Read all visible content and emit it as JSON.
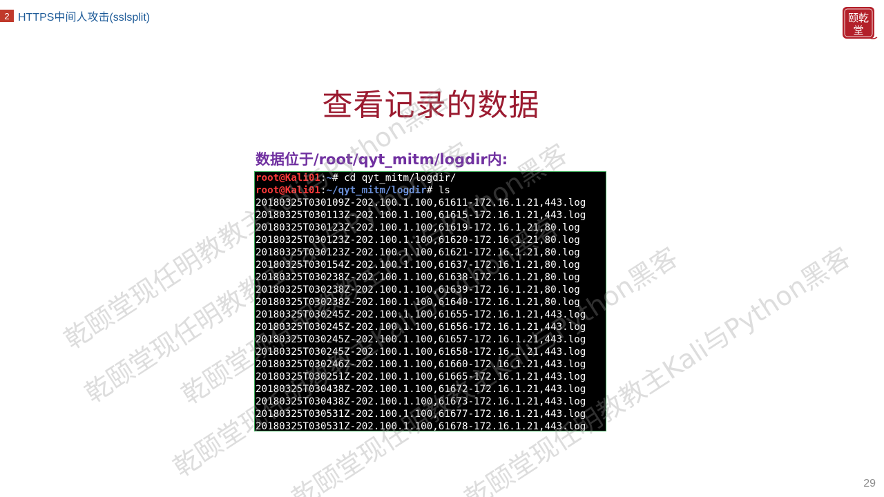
{
  "header": {
    "section_number": "2",
    "section_title": "HTTPS中间人攻击(sslsplit)"
  },
  "seal": {
    "text_top": "颐乾",
    "text_bottom": "堂"
  },
  "slide": {
    "title": "查看记录的数据",
    "subtitle": "数据位于/root/qyt_mitm/logdir内:"
  },
  "terminal": {
    "command1": {
      "user": "root@Kali01",
      "sep": ":",
      "path": "~",
      "suffix": "# cd qyt_mitm/logdir/"
    },
    "command2": {
      "user": "root@Kali01",
      "sep": ":",
      "path": "~/qyt_mitm/logdir",
      "suffix": "# ls"
    },
    "files": [
      "20180325T030109Z-202.100.1.100,61611-172.16.1.21,443.log",
      "20180325T030113Z-202.100.1.100,61615-172.16.1.21,443.log",
      "20180325T030123Z-202.100.1.100,61619-172.16.1.21,80.log",
      "20180325T030123Z-202.100.1.100,61620-172.16.1.21,80.log",
      "20180325T030123Z-202.100.1.100,61621-172.16.1.21,80.log",
      "20180325T030154Z-202.100.1.100,61637-172.16.1.21,80.log",
      "20180325T030238Z-202.100.1.100,61638-172.16.1.21,80.log",
      "20180325T030238Z-202.100.1.100,61639-172.16.1.21,80.log",
      "20180325T030238Z-202.100.1.100,61640-172.16.1.21,80.log",
      "20180325T030245Z-202.100.1.100,61655-172.16.1.21,443.log",
      "20180325T030245Z-202.100.1.100,61656-172.16.1.21,443.log",
      "20180325T030245Z-202.100.1.100,61657-172.16.1.21,443.log",
      "20180325T030245Z-202.100.1.100,61658-172.16.1.21,443.log",
      "20180325T030246Z-202.100.1.100,61660-172.16.1.21,443.log",
      "20180325T030251Z-202.100.1.100,61665-172.16.1.21,443.log",
      "20180325T030438Z-202.100.1.100,61672-172.16.1.21,443.log",
      "20180325T030438Z-202.100.1.100,61673-172.16.1.21,443.log",
      "20180325T030531Z-202.100.1.100,61677-172.16.1.21,443.log",
      "20180325T030531Z-202.100.1.100,61678-172.16.1.21,443.log"
    ]
  },
  "watermark_text": "乾颐堂现任明教教主Kali与Python黑客",
  "page_number": "29",
  "colors": {
    "badge": "#c0392b",
    "section_title": "#1f5c99",
    "slide_title": "#9b1b30",
    "subtitle": "#7030a0",
    "prompt_user": "#ff3a3a",
    "prompt_path": "#6a8fd8",
    "terminal_border": "#3fae5b"
  }
}
